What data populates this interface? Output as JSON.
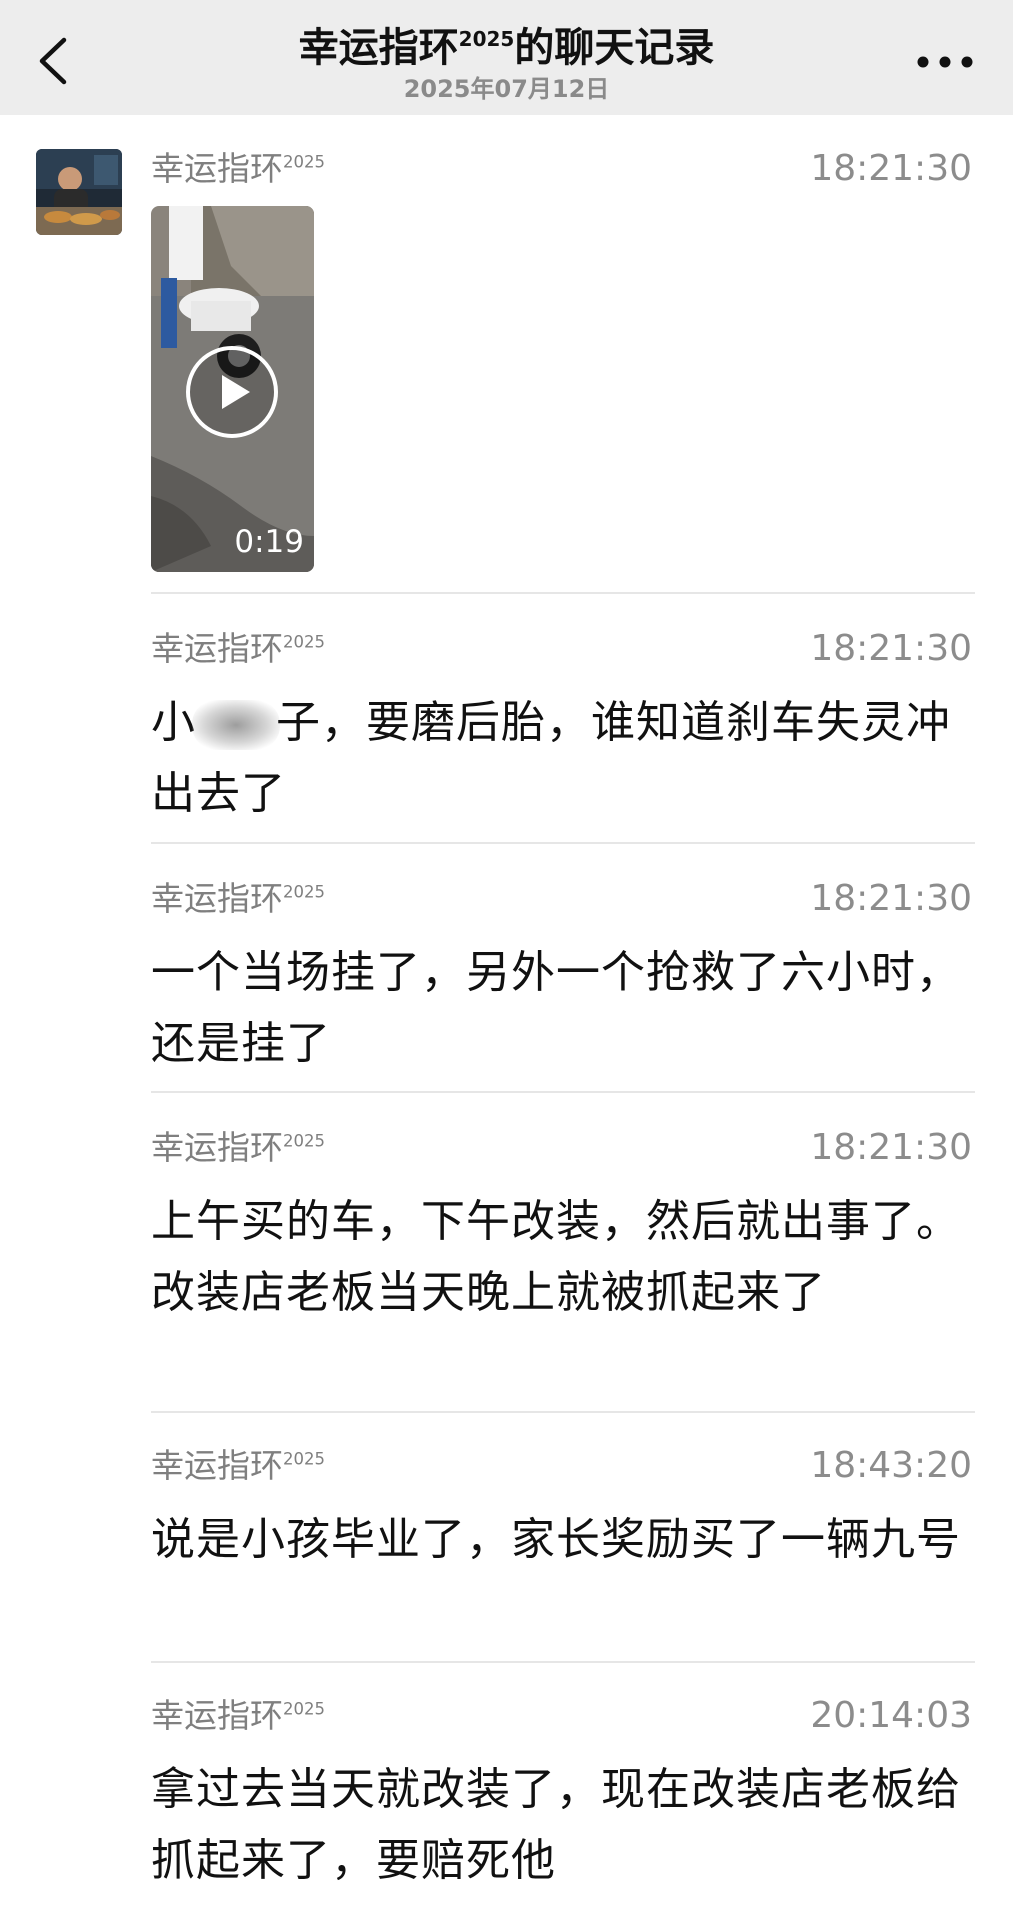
{
  "header": {
    "title_prefix": "幸运指环",
    "title_sup": "2025",
    "title_suffix": "的聊天记录",
    "subtitle": "2025年07月12日"
  },
  "sender": {
    "name": "幸运指环",
    "name_sup": "2025"
  },
  "messages": [
    {
      "time": "18:21:30",
      "type": "video",
      "duration": "0:19"
    },
    {
      "time": "18:21:30",
      "type": "text",
      "text_pre": "小",
      "text_post": "子，要磨后胎，谁知道刹车失灵冲出去了"
    },
    {
      "time": "18:21:30",
      "type": "text",
      "text": "一个当场挂了，另外一个抢救了六小时，还是挂了"
    },
    {
      "time": "18:21:30",
      "type": "text",
      "text": "上午买的车，下午改装，然后就出事了。改装店老板当天晚上就被抓起来了"
    },
    {
      "time": "18:43:20",
      "type": "text",
      "text": "说是小孩毕业了，家长奖励买了一辆九号"
    },
    {
      "time": "20:14:03",
      "type": "text",
      "text": "拿过去当天就改装了，现在改装店老板给抓起来了，要赔死他"
    }
  ]
}
